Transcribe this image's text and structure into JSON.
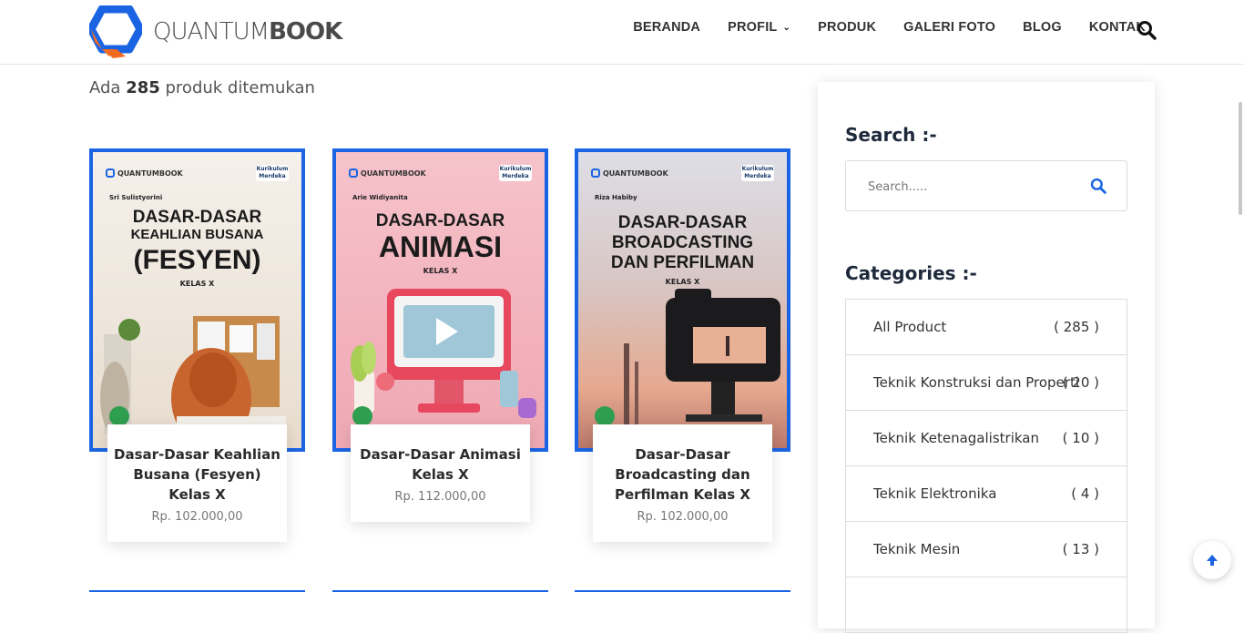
{
  "brand": {
    "light": "QUANTUM",
    "bold": "BOOK",
    "accent": "#1a64e3",
    "orange": "#f26b21"
  },
  "nav": {
    "items": [
      {
        "label": "BERANDA"
      },
      {
        "label": "PROFIL",
        "dropdown": true
      },
      {
        "label": "PRODUK"
      },
      {
        "label": "GALERI FOTO"
      },
      {
        "label": "BLOG"
      },
      {
        "label": "KONTAK"
      }
    ],
    "search_icon": "search-icon"
  },
  "results": {
    "prefix": "Ada",
    "count": "285",
    "suffix": "produk ditemukan"
  },
  "products": [
    {
      "name": "Dasar-Dasar Keahlian Busana (Fesyen) Kelas X",
      "price": "Rp. 102.000,00",
      "cover": {
        "brand": "QUANTUMBOOK",
        "badge": "Kurikulum Merdeka",
        "author": "Sri Sulistyorini",
        "title_lines": [
          "DASAR-DASAR",
          "KEAHLIAN BUSANA",
          "(FESYEN)"
        ],
        "class": "KELAS X",
        "bg": "#f0ebe4"
      }
    },
    {
      "name": "Dasar-Dasar Animasi Kelas X",
      "price": "Rp. 112.000,00",
      "cover": {
        "brand": "QUANTUMBOOK",
        "badge": "Kurikulum Merdeka",
        "author": "Arie Widiyanita",
        "title_lines": [
          "DASAR-DASAR",
          "ANIMASI"
        ],
        "class": "KELAS X",
        "bg": "#f4b7c0"
      }
    },
    {
      "name": "Dasar-Dasar Broadcasting dan Perfilman Kelas X",
      "price": "Rp. 102.000,00",
      "cover": {
        "brand": "QUANTUMBOOK",
        "badge": "Kurikulum Merdeka",
        "author": "Riza Habiby",
        "title_lines": [
          "DASAR-DASAR",
          "BROADCASTING",
          "DAN PERFILMAN"
        ],
        "class": "KELAS X",
        "bg": "#e9c9b8"
      }
    }
  ],
  "sidebar": {
    "search_title": "Search :-",
    "search_placeholder": "Search.....",
    "categories_title": "Categories :-",
    "categories": [
      {
        "name": "All Product",
        "count": "( 285 )"
      },
      {
        "name": "Teknik Konstruksi dan Properti",
        "count": "( 20 )"
      },
      {
        "name": "Teknik Ketenagalistrikan",
        "count": "( 10 )"
      },
      {
        "name": "Teknik Elektronika",
        "count": "( 4 )"
      },
      {
        "name": "Teknik Mesin",
        "count": "( 13 )"
      }
    ]
  }
}
